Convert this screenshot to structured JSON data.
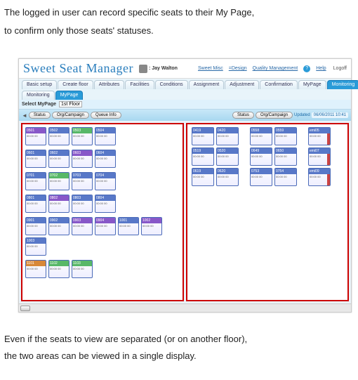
{
  "caption_top_line1": "The logged in user can record specific seats to their My Page,",
  "caption_top_line2": "to confirm only those seats' statuses.",
  "caption_bottom_line1": "Even if the seats to view are separated (or on another floor),",
  "caption_bottom_line2": "the two areas can be viewed in a single display.",
  "app": {
    "title": "Sweet Seat Manager",
    "user_prefix": ": Jay Walton",
    "links": {
      "misc": "Sweet Misc",
      "design": "=Design",
      "qm": "Quality Management",
      "help": "Help",
      "logoff": "Logoff"
    }
  },
  "tabs_row1": [
    "Basic setup",
    "Create floor",
    "Attributes",
    "Facilities",
    "Conditions",
    "Assignment",
    "Adjustment",
    "Confirmation",
    "MyPage",
    "Monitoring"
  ],
  "tabs_row1_active": 9,
  "tabs_row2": [
    "Monitoring",
    "MyPage"
  ],
  "tabs_row2_active": 1,
  "subbar": {
    "label": "Select MyPage",
    "value": "1st Floor"
  },
  "toolbar_left": {
    "status": "Status",
    "org": "Org/Campaign",
    "queue": "Queue Info"
  },
  "toolbar_right": {
    "status": "Status",
    "org": "Org/Campaign",
    "updated_label": "Updated",
    "timestamp": "06/06/2011 10:41"
  },
  "left_seats": [
    {
      "id": "0501",
      "style": "purple"
    },
    {
      "id": "0502",
      "style": "blue"
    },
    {
      "id": "0503",
      "style": "green"
    },
    {
      "id": "0504",
      "style": "blue"
    },
    {
      "id": "0601",
      "style": "blue"
    },
    {
      "id": "0602",
      "style": "blue"
    },
    {
      "id": "0603",
      "style": "purple"
    },
    {
      "id": "0604",
      "style": "blue"
    },
    {
      "id": "0701",
      "style": "blue"
    },
    {
      "id": "0702",
      "style": "green"
    },
    {
      "id": "0703",
      "style": "blue"
    },
    {
      "id": "0704",
      "style": "blue"
    },
    {
      "id": "0801",
      "style": "blue"
    },
    {
      "id": "0802",
      "style": "purple"
    },
    {
      "id": "0803",
      "style": "blue"
    },
    {
      "id": "0804",
      "style": "blue"
    },
    {
      "id": "0901",
      "style": "blue"
    },
    {
      "id": "0902",
      "style": "blue"
    },
    {
      "id": "0903",
      "style": "purple"
    },
    {
      "id": "0904",
      "style": "purple"
    },
    {
      "id": "1001",
      "style": "blue"
    },
    {
      "id": "1002",
      "style": "purple"
    },
    {
      "id": "1003",
      "style": "blue"
    },
    {
      "id": "1101",
      "style": "orange"
    },
    {
      "id": "1102",
      "style": "green"
    },
    {
      "id": "1103",
      "style": "green"
    }
  ],
  "right_seats_g1": [
    {
      "id": "0419",
      "style": "blue"
    },
    {
      "id": "0420",
      "style": "blue"
    },
    {
      "id": "0519",
      "style": "blue"
    },
    {
      "id": "0520",
      "style": "blue"
    },
    {
      "id": "0619",
      "style": "blue"
    },
    {
      "id": "0620",
      "style": "blue"
    }
  ],
  "right_seats_g2": [
    {
      "id": "0558",
      "style": "blue"
    },
    {
      "id": "0559",
      "style": "blue"
    },
    {
      "id": "0649",
      "style": "blue"
    },
    {
      "id": "0650",
      "style": "blue"
    },
    {
      "id": "0753",
      "style": "blue"
    },
    {
      "id": "0754",
      "style": "blue"
    }
  ],
  "right_seats_g3": [
    {
      "id": "emi05",
      "style": "blue",
      "red": true
    },
    {
      "id": "emi07",
      "style": "blue",
      "red": true
    },
    {
      "id": "emi09",
      "style": "blue",
      "red": true
    }
  ]
}
